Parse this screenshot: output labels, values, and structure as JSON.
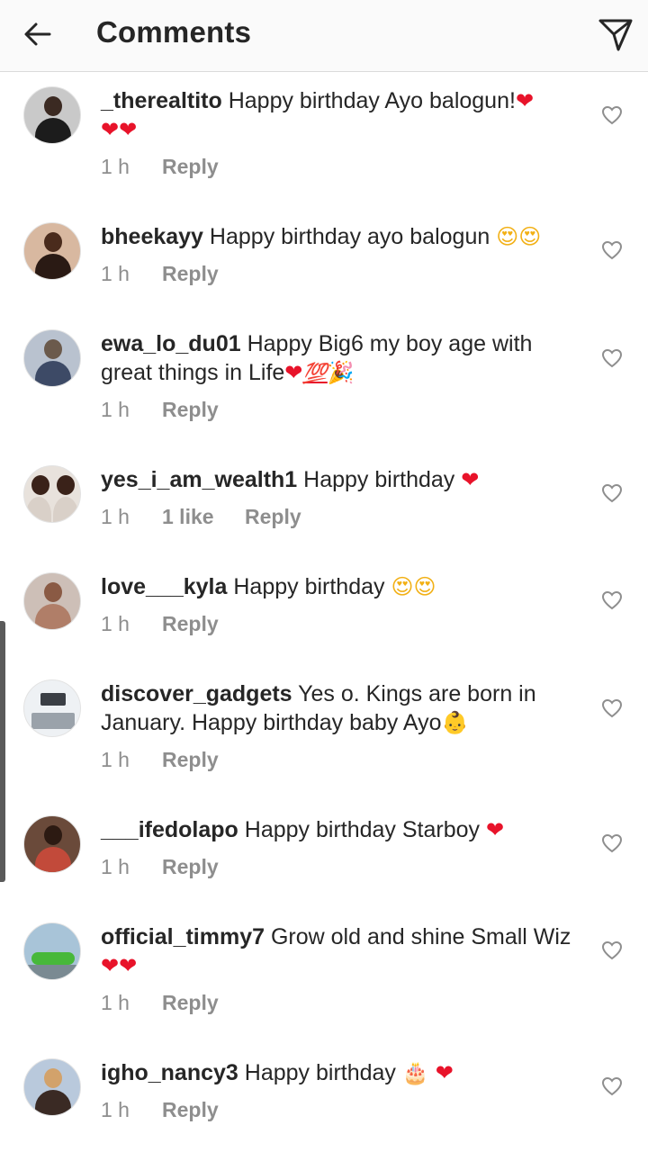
{
  "header": {
    "title": "Comments",
    "back_icon": "arrow-left-icon",
    "share_icon": "paper-plane-icon"
  },
  "colors": {
    "text": "#262626",
    "meta": "#8e8e8e",
    "heart": "#e8132a",
    "header_bg": "#fafafa"
  },
  "comments": [
    {
      "username": "_therealtito",
      "text": "Happy birthday Ayo balogun!",
      "emojis": [
        "❤",
        "❤",
        "❤"
      ],
      "time": "1 h",
      "likes": "",
      "reply": "Reply"
    },
    {
      "username": "bheekayy",
      "text": "Happy birthday ayo balogun",
      "emojis": [
        "😍",
        "😍"
      ],
      "time": "1 h",
      "likes": "",
      "reply": "Reply"
    },
    {
      "username": "ewa_lo_du01",
      "text": "Happy Big6 my boy age with great things in Life",
      "emojis": [
        "❤",
        "💯",
        "🎉"
      ],
      "time": "1 h",
      "likes": "",
      "reply": "Reply"
    },
    {
      "username": "yes_i_am_wealth1",
      "text": "Happy birthday",
      "emojis": [
        "❤"
      ],
      "time": "1 h",
      "likes": "1 like",
      "reply": "Reply"
    },
    {
      "username": "love___kyla",
      "text": "Happy birthday",
      "emojis": [
        "😍",
        "😍"
      ],
      "time": "1 h",
      "likes": "",
      "reply": "Reply"
    },
    {
      "username": "discover_gadgets",
      "text": "Yes o. Kings are born in January. Happy birthday baby Ayo",
      "emojis": [
        "👶"
      ],
      "time": "1 h",
      "likes": "",
      "reply": "Reply"
    },
    {
      "username": "___ifedolapo",
      "text": "Happy birthday Starboy",
      "emojis": [
        "❤"
      ],
      "time": "1 h",
      "likes": "",
      "reply": "Reply"
    },
    {
      "username": "official_timmy7",
      "text": "Grow old and shine Small Wiz",
      "emojis": [
        "❤",
        "❤"
      ],
      "time": "1 h",
      "likes": "",
      "reply": "Reply"
    },
    {
      "username": "igho_nancy3",
      "text": "Happy birthday",
      "emojis": [
        "🎂",
        "❤"
      ],
      "time": "1 h",
      "likes": "",
      "reply": "Reply"
    }
  ]
}
